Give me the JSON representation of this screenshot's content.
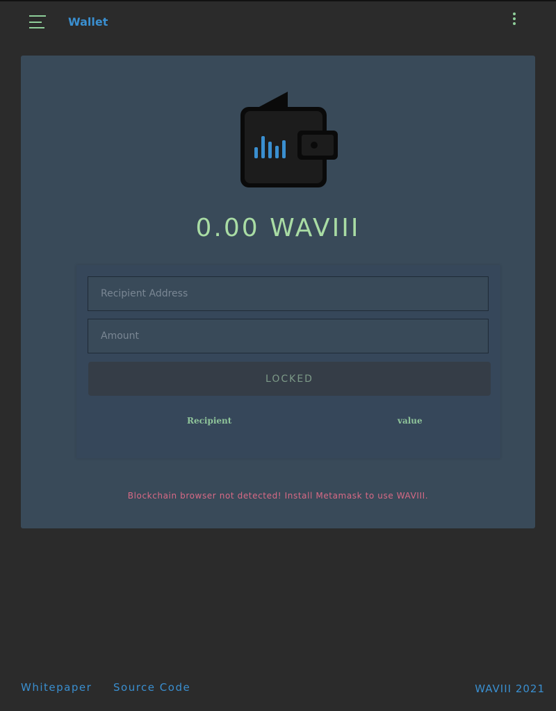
{
  "header": {
    "title": "Wallet",
    "menu_icon": "hamburger-icon",
    "more_icon": "more-vertical-icon"
  },
  "wallet": {
    "icon": "wallet-icon",
    "balance": "0.00 WAVIII"
  },
  "form": {
    "recipient_placeholder": "Recipient Address",
    "amount_placeholder": "Amount",
    "button_label": "Locked",
    "columns": [
      "Recipient",
      "value"
    ]
  },
  "warning": "Blockchain browser not detected! Install Metamask to use WAVIII.",
  "footer": {
    "links": [
      "Whitepaper",
      "Source Code"
    ],
    "copyright": "WAVIII 2021"
  },
  "colors": {
    "background": "#2b2b2b",
    "card": "#394a59",
    "accent_blue": "#3a8fd0",
    "accent_green": "#a9dca4",
    "warning": "#d96a86"
  }
}
